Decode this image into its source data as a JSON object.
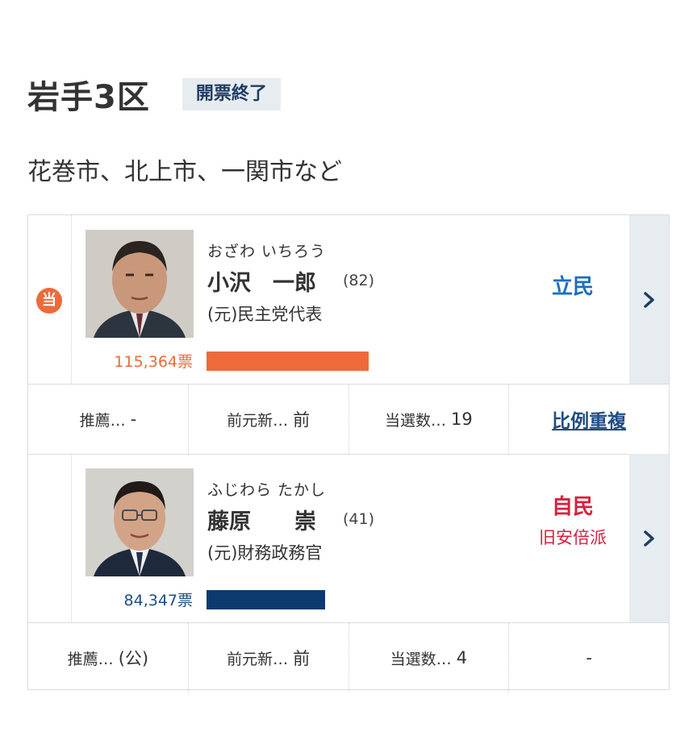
{
  "district": {
    "name": "岩手3区",
    "status": "開票終了",
    "area": "花巻市、北上市、一関市など"
  },
  "candidates": [
    {
      "winner_mark": "当",
      "kana": "おざわ いちろう",
      "name": "小沢　一郎",
      "age": "(82)",
      "title": "(元)民主党代表",
      "votes": "115,364票",
      "vote_share_of_max": 1.0,
      "party": "立民",
      "faction": "",
      "bar_color": "#ee6a3a",
      "details": {
        "endorse_label": "推薦…",
        "endorse_value": "-",
        "status_label": "前元新…",
        "status_value": "前",
        "wins_label": "当選数…",
        "wins_value": "19",
        "proportional": "比例重複"
      }
    },
    {
      "winner_mark": "",
      "kana": "ふじわら たかし",
      "name": "藤原　　崇",
      "age": "(41)",
      "title": "(元)財務政務官",
      "votes": "84,347票",
      "vote_share_of_max": 0.731,
      "party": "自民",
      "faction": "旧安倍派",
      "bar_color": "#0d3a6e",
      "details": {
        "endorse_label": "推薦…",
        "endorse_value": "(公)",
        "status_label": "前元新…",
        "status_value": "前",
        "wins_label": "当選数…",
        "wins_value": "4",
        "proportional": "-"
      }
    }
  ],
  "colors": {
    "accent_orange": "#ee6a3a",
    "party_cdp": "#1d6fc1",
    "party_ldp": "#d6213f",
    "badge_bg": "#e7ecf1",
    "navy": "#1f4e84"
  },
  "icons": {
    "winner": "winner-badge-icon",
    "detail": "chevron-right-icon"
  }
}
